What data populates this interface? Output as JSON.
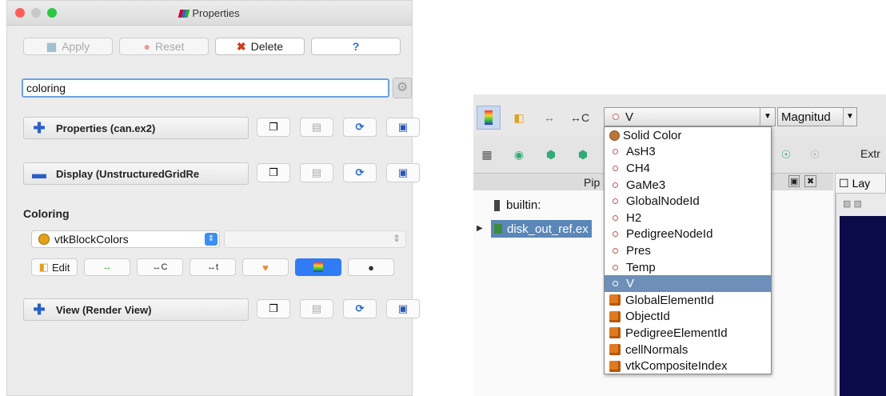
{
  "left": {
    "window_title": "Properties",
    "buttons": {
      "apply": "Apply",
      "reset": "Reset",
      "delete": "Delete",
      "help": "?"
    },
    "search": {
      "value": "coloring"
    },
    "sections": {
      "properties": "Properties (can.ex2)",
      "display": "Display (UnstructuredGridRe",
      "view": "View (Render View)"
    },
    "coloring_label": "Coloring",
    "coloring_combo": "vtkBlockColors",
    "edit_label": "Edit"
  },
  "right": {
    "color_combo": "V",
    "component_combo": "Magnitud",
    "toolbar_right_text": "Extr",
    "pipeline_label": "Pip",
    "layout_label": "Lay",
    "tree": {
      "builtin": "builtin:",
      "source": "disk_out_ref.ex"
    },
    "dropdown_items": [
      {
        "label": "Solid Color",
        "kind": "solid"
      },
      {
        "label": "AsH3",
        "kind": "point"
      },
      {
        "label": "CH4",
        "kind": "point"
      },
      {
        "label": "GaMe3",
        "kind": "point"
      },
      {
        "label": "GlobalNodeId",
        "kind": "point"
      },
      {
        "label": "H2",
        "kind": "point"
      },
      {
        "label": "PedigreeNodeId",
        "kind": "point"
      },
      {
        "label": "Pres",
        "kind": "point"
      },
      {
        "label": "Temp",
        "kind": "point"
      },
      {
        "label": "V",
        "kind": "point",
        "selected": true
      },
      {
        "label": "GlobalElementId",
        "kind": "cell"
      },
      {
        "label": "ObjectId",
        "kind": "cell"
      },
      {
        "label": "PedigreeElementId",
        "kind": "cell"
      },
      {
        "label": "cellNormals",
        "kind": "cell"
      },
      {
        "label": "vtkCompositeIndex",
        "kind": "cell"
      }
    ]
  },
  "colors": {
    "accent_blue": "#2f7cf6",
    "selection": "#6d8fb8",
    "cell_icon": "#e07a1c",
    "solid_icon": "#b87638"
  }
}
